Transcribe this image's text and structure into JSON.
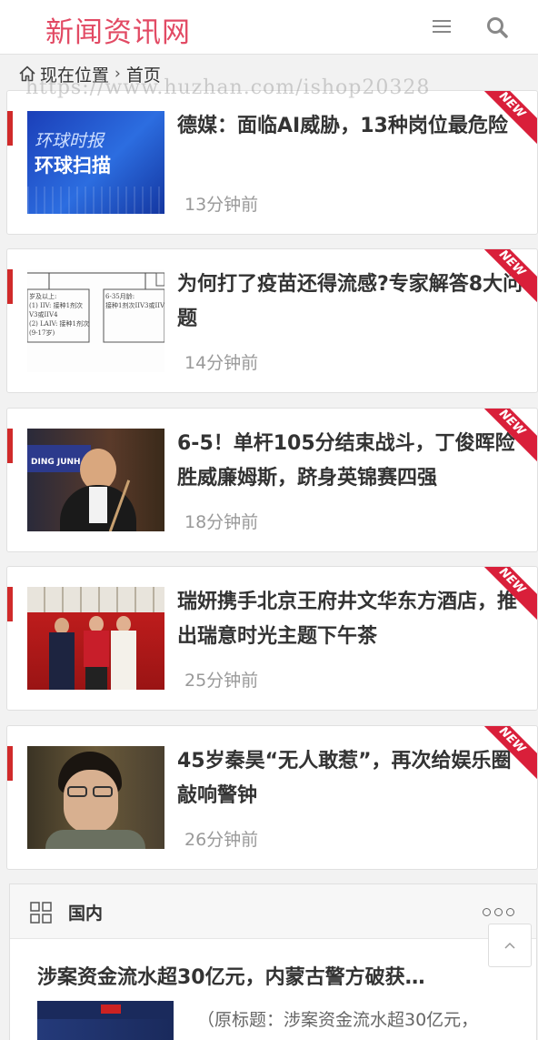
{
  "header": {
    "logo": "新闻资讯网",
    "menu_icon": "hamburger-menu-icon",
    "search_icon": "search-icon"
  },
  "breadcrumb": {
    "prefix": "现在位置",
    "separator": "›",
    "current": "首页"
  },
  "watermark": "https://www.huzhan.com/ishop20328",
  "articles": [
    {
      "title": "德媒：面临AI威胁，13种岗位最危险",
      "time": "13分钟前",
      "badge": "NEW",
      "thumb_text": "环球扫描",
      "thumb_small": "环球时报"
    },
    {
      "title": "为何打了疫苗还得流感?专家解答8大问题",
      "time": "14分钟前",
      "badge": "NEW"
    },
    {
      "title": "6-5！单杆105分结束战斗，丁俊晖险胜威廉姆斯，跻身英锦赛四强",
      "time": "18分钟前",
      "badge": "NEW",
      "thumb_text": "DING JUNH"
    },
    {
      "title": "瑞妍携手北京王府井文华东方酒店，推出瑞意时光主题下午茶",
      "time": "25分钟前",
      "badge": "NEW"
    },
    {
      "title": "45岁秦昊“无人敢惹”，再次给娱乐圈敲响警钟",
      "time": "26分钟前",
      "badge": "NEW"
    }
  ],
  "section": {
    "title": "国内",
    "first_title": "涉案资金流水超30亿元，内蒙古警方破获…",
    "excerpt": "（原标题：涉案资金流水超30亿元，"
  },
  "colors": {
    "brand": "#e24a64",
    "accent": "#d02a2a",
    "badge": "#d91f3a"
  }
}
